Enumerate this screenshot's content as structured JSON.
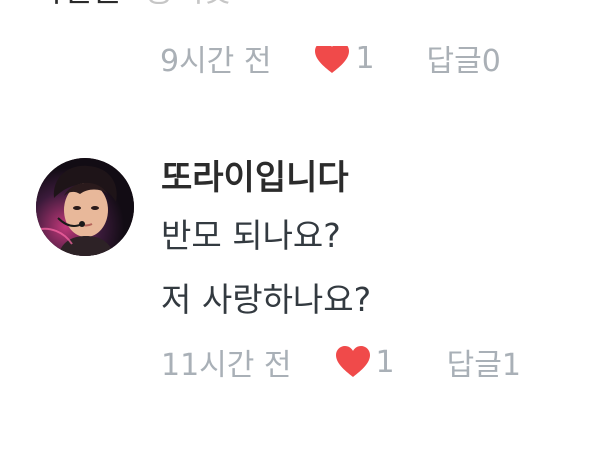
{
  "previous_comment": {
    "text_dark": "파란눈",
    "text_muted": "동백꽃",
    "time": "9시간 전",
    "like_count": "1",
    "reply_label": "답글",
    "reply_count": "0"
  },
  "reply": {
    "author": "또라이입니다",
    "lines": [
      "반모 되나요?",
      "저 사랑하나요?"
    ],
    "time": "11시간 전",
    "like_count": "1",
    "reply_label": "답글",
    "reply_count": "1"
  },
  "colors": {
    "heart": "#f04a4a",
    "meta_text": "#a9b0b7",
    "author_text": "#2b2b2b",
    "body_text": "#333a40"
  },
  "icons": {
    "heart": "heart-icon"
  }
}
